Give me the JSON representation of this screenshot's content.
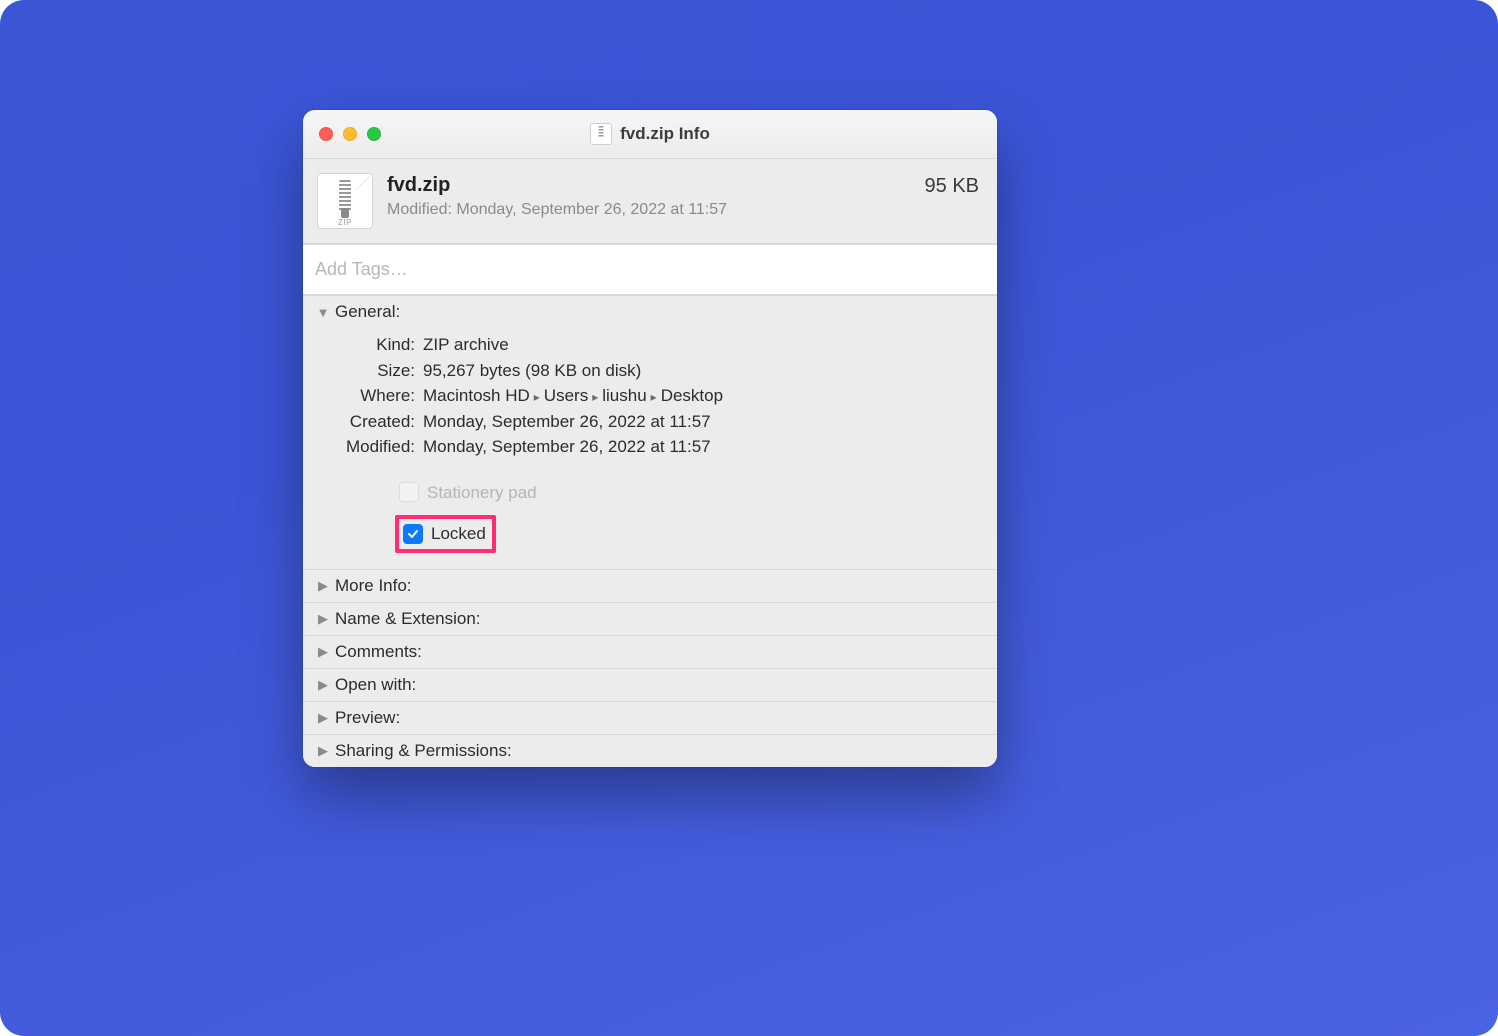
{
  "window": {
    "title": "fvd.zip Info"
  },
  "summary": {
    "filename": "fvd.zip",
    "modified_line": "Modified: Monday, September 26, 2022 at 11:57",
    "size_display": "95 KB"
  },
  "tags": {
    "placeholder": "Add Tags…",
    "value": ""
  },
  "general": {
    "header": "General:",
    "kind_label": "Kind:",
    "kind_value": "ZIP archive",
    "size_label": "Size:",
    "size_value": "95,267 bytes (98 KB on disk)",
    "where_label": "Where:",
    "where_path": [
      "Macintosh HD",
      "Users",
      "liushu",
      "Desktop"
    ],
    "created_label": "Created:",
    "created_value": "Monday, September 26, 2022 at 11:57",
    "modified_label": "Modified:",
    "modified_value": "Monday, September 26, 2022 at 11:57",
    "stationery_label": "Stationery pad",
    "stationery_checked": false,
    "stationery_enabled": false,
    "locked_label": "Locked",
    "locked_checked": true
  },
  "sections": {
    "more_info": "More Info:",
    "name_ext": "Name & Extension:",
    "comments": "Comments:",
    "open_with": "Open with:",
    "preview": "Preview:",
    "sharing": "Sharing & Permissions:"
  },
  "file_icon": {
    "ext_label": "ZIP"
  }
}
